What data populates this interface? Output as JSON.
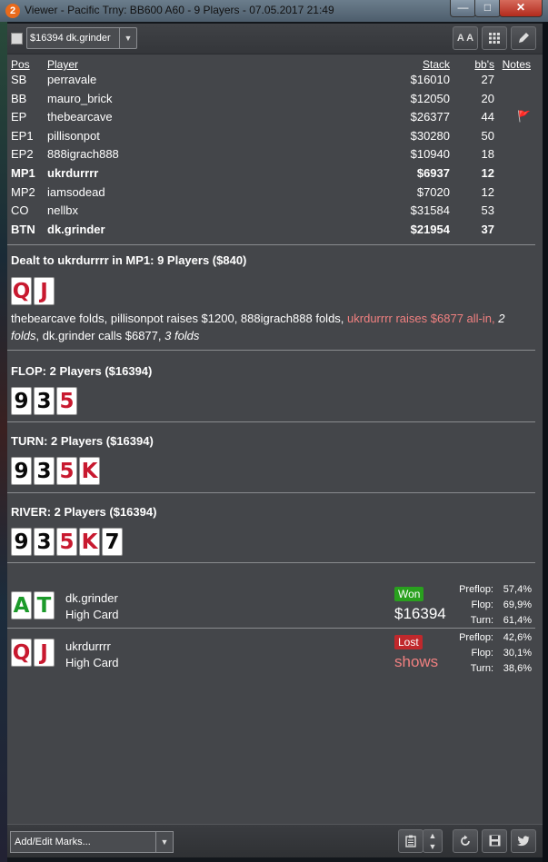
{
  "window": {
    "app_icon": "2",
    "title": "Viewer - Pacific Trny: BB600 A60 - 9 Players - 07.05.2017 21:49",
    "min_label": "—",
    "max_label": "□",
    "close_label": "✕"
  },
  "toolbar": {
    "hand_select_value": "$16394 dk.grinder",
    "font_button_label": "A A",
    "grid_icon": "grid-icon",
    "edit_icon": "pencil-icon"
  },
  "players": {
    "headers": {
      "pos": "Pos",
      "player": "Player",
      "stack": "Stack",
      "bbs": "bb's",
      "notes": "Notes"
    },
    "rows": [
      {
        "pos": "SB",
        "name": "perravale",
        "stack": "$16010",
        "bbs": "27",
        "note": ""
      },
      {
        "pos": "BB",
        "name": "mauro_brick",
        "stack": "$12050",
        "bbs": "20",
        "note": ""
      },
      {
        "pos": "EP",
        "name": "thebearcave",
        "stack": "$26377",
        "bbs": "44",
        "note": "🚩"
      },
      {
        "pos": "EP1",
        "name": "pillisonpot",
        "stack": "$30280",
        "bbs": "50",
        "note": ""
      },
      {
        "pos": "EP2",
        "name": "888igrach888",
        "stack": "$10940",
        "bbs": "18",
        "note": ""
      },
      {
        "pos": "MP1",
        "name": "ukrdurrrr",
        "stack": "$6937",
        "bbs": "12",
        "note": ""
      },
      {
        "pos": "MP2",
        "name": "iamsodead",
        "stack": "$7020",
        "bbs": "12",
        "note": ""
      },
      {
        "pos": "CO",
        "name": "nellbx",
        "stack": "$31584",
        "bbs": "53",
        "note": ""
      },
      {
        "pos": "BTN",
        "name": "dk.grinder",
        "stack": "$21954",
        "bbs": "37",
        "note": ""
      }
    ]
  },
  "preflop": {
    "title": "Dealt to ukrdurrrr in MP1: 9 Players ($840)",
    "cards": [
      "Q",
      "J"
    ],
    "actions": [
      {
        "text": "thebearcave folds, pillisonpot raises $1200, 888igrach888 folds, "
      },
      {
        "text": "ukrdurrrr raises $6877 all-in,"
      },
      {
        "text": "2 folds"
      },
      {
        "text": ", dk.grinder calls $6877, "
      },
      {
        "text": "3 folds"
      }
    ]
  },
  "flop": {
    "title": "FLOP: 2 Players ($16394)",
    "cards": [
      "9",
      "3",
      "5"
    ]
  },
  "turn": {
    "title": "TURN: 2 Players ($16394)",
    "cards": [
      "9",
      "3",
      "5",
      "K"
    ]
  },
  "river": {
    "title": "RIVER: 2 Players ($16394)",
    "cards": [
      "9",
      "3",
      "5",
      "K",
      "7"
    ]
  },
  "results": [
    {
      "cards": [
        "A",
        "T"
      ],
      "name": "dk.grinder",
      "hand": "High Card",
      "badge": "Won",
      "amount": "$16394",
      "equity": [
        {
          "label": "Preflop:",
          "value": "57,4%"
        },
        {
          "label": "Flop:",
          "value": "69,9%"
        },
        {
          "label": "Turn:",
          "value": "61,4%"
        }
      ]
    },
    {
      "cards": [
        "Q",
        "J"
      ],
      "name": "ukrdurrrr",
      "hand": "High Card",
      "badge": "Lost",
      "amount": "shows",
      "equity": [
        {
          "label": "Preflop:",
          "value": "42,6%"
        },
        {
          "label": "Flop:",
          "value": "30,1%"
        },
        {
          "label": "Turn:",
          "value": "38,6%"
        }
      ]
    }
  ],
  "footer": {
    "marks_select_value": "Add/Edit Marks...",
    "icons": [
      "clipboard-icon",
      "spinner-icon",
      "refresh-icon",
      "save-icon",
      "twitter-icon"
    ]
  }
}
